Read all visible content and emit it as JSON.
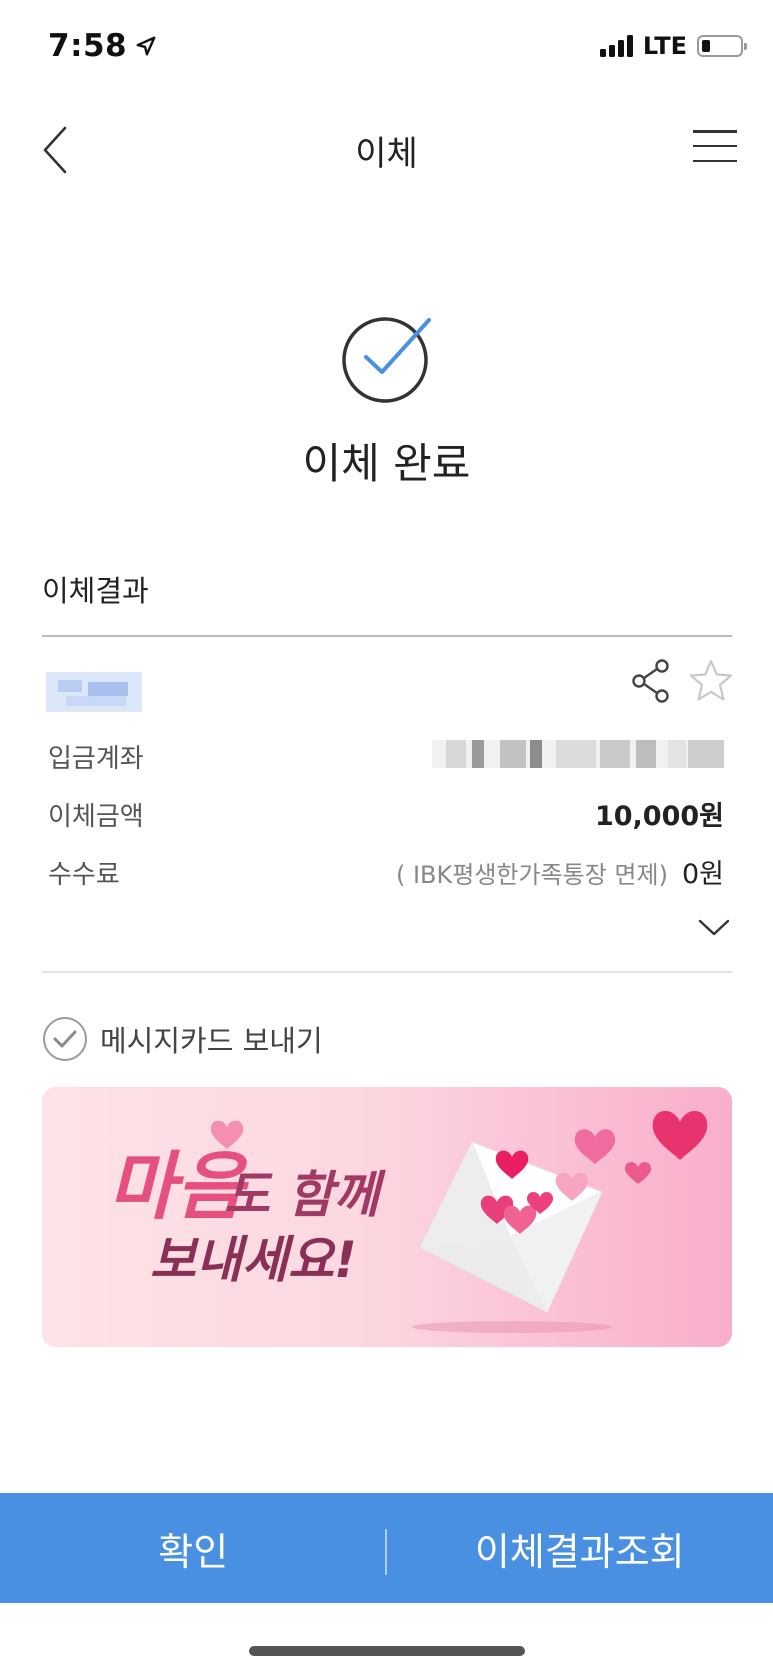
{
  "status_bar": {
    "time": "7:58",
    "network": "LTE"
  },
  "header": {
    "title": "이체"
  },
  "completion": {
    "title": "이체 완료"
  },
  "result": {
    "section_title": "이체결과",
    "rows": {
      "account": {
        "label": "입금계좌"
      },
      "amount": {
        "label": "이체금액",
        "value": "10,000원"
      },
      "fee": {
        "label": "수수료",
        "note": "( IBK평생한가족통장 면제)",
        "value": "0원"
      }
    }
  },
  "message_card": {
    "label": "메시지카드 보내기"
  },
  "banner": {
    "line1_big": "마음",
    "line1_rest": "도 함께",
    "line2": "보내세요!"
  },
  "buttons": {
    "confirm": "확인",
    "view_result": "이체결과조회"
  },
  "colors": {
    "primary": "#4a90e2",
    "check_blue": "#4a90e2",
    "banner_text_pink": "#e5507e",
    "banner_text_plum": "#8a2f55"
  },
  "icons": {
    "back": "chevron-left-icon",
    "menu": "hamburger-menu-icon",
    "done": "check-circle-icon",
    "share": "share-icon",
    "favorite": "star-icon",
    "expand": "chevron-down-icon",
    "message_card_check": "check-circle-icon"
  }
}
